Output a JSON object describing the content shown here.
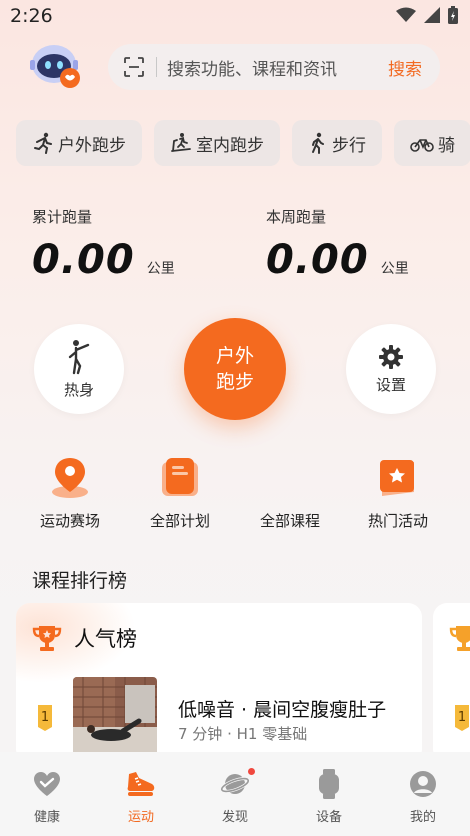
{
  "status": {
    "time": "2:26"
  },
  "search": {
    "placeholder": "搜索功能、课程和资讯",
    "button": "搜索"
  },
  "chips": [
    {
      "label": "户外跑步",
      "icon": "outdoor-run-icon"
    },
    {
      "label": "室内跑步",
      "icon": "treadmill-icon"
    },
    {
      "label": "步行",
      "icon": "walk-icon"
    },
    {
      "label": "骑",
      "icon": "bike-icon"
    }
  ],
  "stats": {
    "total": {
      "label": "累计跑量",
      "value": "0.00",
      "unit": "公里"
    },
    "week": {
      "label": "本周跑量",
      "value": "0.00",
      "unit": "公里"
    }
  },
  "actions": {
    "warmup": "热身",
    "start_line1": "户外",
    "start_line2": "跑步",
    "settings": "设置"
  },
  "quick": [
    {
      "label": "运动赛场",
      "icon": "location-pin-icon"
    },
    {
      "label": "全部计划",
      "icon": "plan-icon"
    },
    {
      "label": "全部课程",
      "icon": "course-icon"
    },
    {
      "label": "热门活动",
      "icon": "star-ticket-icon"
    }
  ],
  "ranking": {
    "section_title": "课程排行榜",
    "card_title": "人气榜",
    "item": {
      "rank": "1",
      "title": "低噪音 · 晨间空腹瘦肚子",
      "subtitle": "7 分钟 · H1 零基础"
    },
    "next_rank": "1"
  },
  "tabs": [
    {
      "label": "健康",
      "icon": "heart-icon",
      "active": false
    },
    {
      "label": "运动",
      "icon": "running-shoe-icon",
      "active": true
    },
    {
      "label": "发现",
      "icon": "planet-icon",
      "active": false
    },
    {
      "label": "设备",
      "icon": "watch-icon",
      "active": false
    },
    {
      "label": "我的",
      "icon": "user-icon",
      "active": false
    }
  ],
  "colors": {
    "accent": "#f46a1f",
    "badge_dot": "#f0483e",
    "medal_gold": "#f5b93a"
  }
}
